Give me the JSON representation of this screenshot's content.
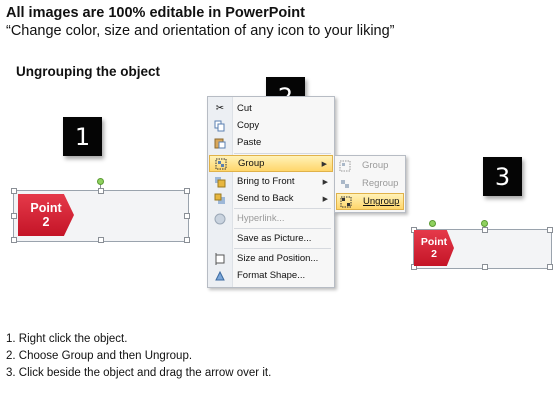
{
  "header": {
    "title": "All images are 100% editable in PowerPoint",
    "subtitle": "“Change color, size and orientation of any icon to your liking”"
  },
  "section_title": "Ungrouping the object",
  "steps": {
    "one": "1",
    "two": "2",
    "three": "3"
  },
  "shape_left": {
    "label_line1": "Point",
    "label_line2": "2"
  },
  "shape_right": {
    "label_line1": "Point",
    "label_line2": "2"
  },
  "context_menu": {
    "items": [
      {
        "label": "Cut",
        "icon": "scissors-icon"
      },
      {
        "label": "Copy",
        "icon": "copy-icon"
      },
      {
        "label": "Paste",
        "icon": "paste-icon"
      },
      {
        "label": "Group",
        "icon": "group-icon",
        "selected": true,
        "submenu": true
      },
      {
        "label": "Bring to Front",
        "icon": "bring-to-front-icon",
        "submenu": true
      },
      {
        "label": "Send to Back",
        "icon": "send-to-back-icon",
        "submenu": true
      },
      {
        "label": "Hyperlink...",
        "icon": "hyperlink-icon",
        "disabled": true
      },
      {
        "label": "Save as Picture...",
        "icon": ""
      },
      {
        "label": "Size and Position...",
        "icon": "size-position-icon"
      },
      {
        "label": "Format Shape...",
        "icon": "format-shape-icon"
      }
    ]
  },
  "group_submenu": {
    "items": [
      {
        "label": "Group",
        "icon": "group-icon",
        "disabled": true
      },
      {
        "label": "Regroup",
        "icon": "regroup-icon",
        "disabled": true
      },
      {
        "label": "Ungroup",
        "icon": "ungroup-icon",
        "selected": true
      }
    ]
  },
  "instructions": [
    "1.  Right click the object.",
    "2.  Choose Group and then Ungroup.",
    "3.  Click beside the object and drag the arrow over it."
  ],
  "colors": {
    "accent_red": "#d61f31",
    "menu_highlight": "#ffd66b"
  }
}
